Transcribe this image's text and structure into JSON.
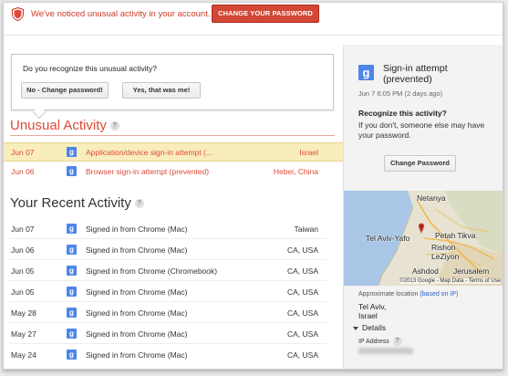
{
  "alert": {
    "message": "We've noticed unusual activity in your account.",
    "button": "CHANGE YOUR PASSWORD"
  },
  "recognize": {
    "question": "Do you recognize this unusual activity?",
    "no_button": "No - Change password!",
    "yes_button": "Yes, that was me!"
  },
  "unusual": {
    "title": "Unusual Activity",
    "help": "?",
    "rows": [
      {
        "date": "Jun 07",
        "activity": "Application/device sign-in attempt (...",
        "location": "Israel"
      },
      {
        "date": "Jun 06",
        "activity": "Browser sign-in attempt (prevented)",
        "location": "Hebei, China"
      }
    ]
  },
  "recent": {
    "title": "Your Recent Activity",
    "help": "?",
    "rows": [
      {
        "date": "Jun 07",
        "activity": "Signed in from Chrome (Mac)",
        "location": "Taiwan"
      },
      {
        "date": "Jun 06",
        "activity": "Signed in from Chrome (Mac)",
        "location": "CA, USA"
      },
      {
        "date": "Jun 05",
        "activity": "Signed in from Chrome (Chromebook)",
        "location": "CA, USA"
      },
      {
        "date": "Jun 05",
        "activity": "Signed in from Chrome (Mac)",
        "location": "CA, USA"
      },
      {
        "date": "May 28",
        "activity": "Signed in from Chrome (Mac)",
        "location": "CA, USA"
      },
      {
        "date": "May 27",
        "activity": "Signed in from Chrome (Mac)",
        "location": "CA, USA"
      },
      {
        "date": "May 24",
        "activity": "Signed in from Chrome (Mac)",
        "location": "CA, USA"
      }
    ]
  },
  "panel": {
    "title": "Sign-in attempt (prevented)",
    "time": "Jun 7 6:05 PM (2 days ago)",
    "question": "Recognize this activity?",
    "description": "If you don't, someone else may have your password.",
    "button": "Change Password",
    "map": {
      "labels": [
        "Netanya",
        "Tel Aviv-Yafo",
        "Petah Tikva",
        "Rishon LeZiyon",
        "Ashdod",
        "Jerusalem"
      ],
      "copyright": "©2013 Google - Map Data - Terms of Use"
    },
    "approx_label": "Approximate location",
    "based_on": "(based on IP)",
    "city": "Tel Aviv,",
    "country": "Israel",
    "details": "Details",
    "ip_label": "IP Address",
    "ip_help": "?"
  },
  "colors": {
    "alert_red": "#dd4b39",
    "highlight_row": "#f9edbe",
    "google_blue": "#4c86e8"
  }
}
